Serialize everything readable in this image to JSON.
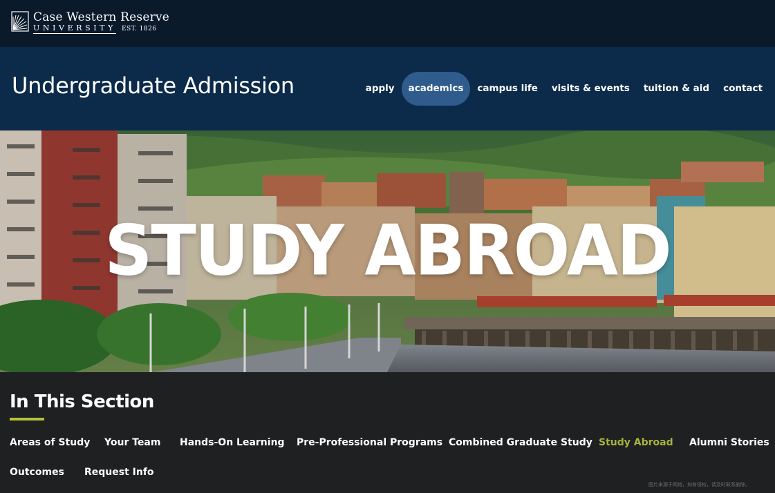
{
  "logo": {
    "line1": "Case Western Reserve",
    "line2": "UNIVERSITY",
    "est": "EST. 1826"
  },
  "header": {
    "title": "Undergraduate Admission",
    "nav": [
      {
        "label": "apply",
        "active": false
      },
      {
        "label": "academics",
        "active": true
      },
      {
        "label": "campus life",
        "active": false
      },
      {
        "label": "visits & events",
        "active": false
      },
      {
        "label": "tuition & aid",
        "active": false
      },
      {
        "label": "contact",
        "active": false
      }
    ]
  },
  "hero": {
    "title": "STUDY ABROAD"
  },
  "section": {
    "heading": "In This Section",
    "items": [
      {
        "label": "Areas of Study",
        "current": false
      },
      {
        "label": "Your Team",
        "current": false
      },
      {
        "label": "Hands-On Learning",
        "current": false
      },
      {
        "label": "Pre-Professional Programs",
        "current": false
      },
      {
        "label": "Combined Graduate Study",
        "current": false
      },
      {
        "label": "Study Abroad",
        "current": true
      },
      {
        "label": "Alumni Stories",
        "current": false
      },
      {
        "label": "Outcomes",
        "current": false
      },
      {
        "label": "Request Info",
        "current": false
      }
    ]
  },
  "watermark": "图片来源于网络，如有侵权，请及时联系删除。",
  "colors": {
    "topbar": "#0a1a2b",
    "header": "#0c2b4a",
    "active_pill": "#2f5c8c",
    "section_bg": "#1f2022",
    "accent": "#b9c13a"
  }
}
